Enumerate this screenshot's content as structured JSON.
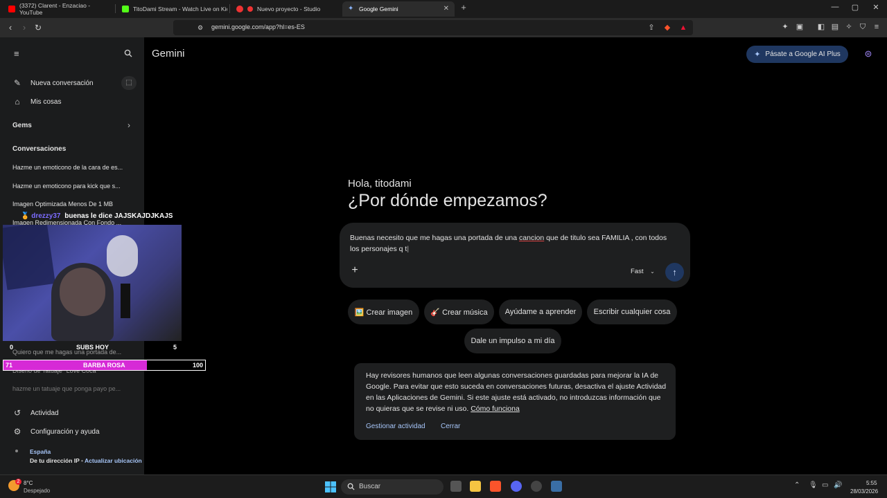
{
  "browser": {
    "tabs": [
      {
        "label": "(3372) Clarent - Enzaciao - YouTube",
        "color": "#ff0000"
      },
      {
        "label": "TitoDami Stream - Watch Live on Kick",
        "color": "#53fc18"
      },
      {
        "label": "Nuevo proyecto - Studio",
        "color": "#e33"
      },
      {
        "label": "Google Gemini",
        "color": "#8ab4f8"
      }
    ],
    "new_tab": "+",
    "url": "gemini.google.com/app?hl=es-ES",
    "window_controls": {
      "minimize": "—",
      "maximize": "▢",
      "close": "✕"
    }
  },
  "sidebar": {
    "menu_icon": "menu-icon",
    "search_icon": "search-icon",
    "new_chat": "Nueva conversación",
    "my_stuff": "Mis cosas",
    "gems": "Gems",
    "conversations_title": "Conversaciones",
    "conversations": [
      "Hazme un emoticono de la cara de es...",
      "Hazme un emoticono para kick que s...",
      "Imagen Optimizada Menos De 1 MB",
      "Imagen Redimensionada Con Fondo ...",
      "Quiero que me hagas una portada de...",
      "Diseño de Tatuaje \"Love Coca\"",
      "hazme un tatuaje que ponga payo pe..."
    ],
    "activity": "Actividad",
    "settings": "Configuración y ayuda",
    "location_country": "España",
    "location_source": "De tu dirección IP",
    "location_update": "Actualizar ubicación"
  },
  "main": {
    "title": "Gemini",
    "upgrade": "Pásate a Google AI Plus",
    "greeting_small": "Hola, titodami",
    "greeting_big": "¿Por dónde empezamos?",
    "prompt": {
      "before": "Buenas necesito que me hagas una portada de una ",
      "misspelled": "cancion",
      "after": " que de titulo sea FAMILIA , con todos los personajes q t",
      "model": "Fast"
    },
    "chips": [
      "🖼️ Crear imagen",
      "🎸 Crear música",
      "Ayúdame a aprender",
      "Escribir cualquier cosa",
      "Dale un impulso a mi día"
    ],
    "notice": {
      "text": "Hay revisores humanos que leen algunas conversaciones guardadas para mejorar la IA de Google. Para evitar que esto suceda en conversaciones futuras, desactiva el ajuste Actividad en las Aplicaciones de Gemini. Si este ajuste está activado, no introduzcas información que no quieras que se revise ni uso.",
      "link": "Cómo funciona",
      "manage": "Gestionar actividad",
      "close": "Cerrar"
    }
  },
  "overlay": {
    "user": "drezzy37",
    "message": "buenas le dice JAJSKAJDJKAJS",
    "subs_left": "0",
    "subs_label": "SUBS HOY",
    "subs_right": "5",
    "bar_left": "71",
    "bar_label": "BARBA ROSA",
    "bar_right": "100",
    "bar_progress": 0.71
  },
  "taskbar": {
    "weather_temp": "8°C",
    "weather_desc": "Despejado",
    "weather_badge": "2",
    "search": "Buscar",
    "time": "5:55",
    "date": "28/03/2026"
  }
}
